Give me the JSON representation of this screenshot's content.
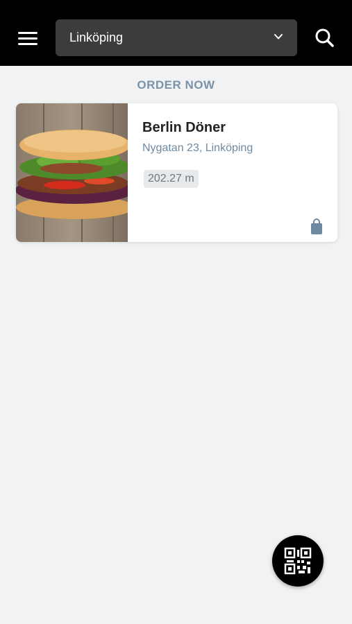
{
  "header": {
    "city_selected": "Linköping"
  },
  "section": {
    "title": "ORDER NOW"
  },
  "restaurants": [
    {
      "name": "Berlin Döner",
      "address": "Nygatan 23, Linköping",
      "distance": "202.27 m"
    }
  ],
  "colors": {
    "header_bg": "#000000",
    "accent": "#7a93a8",
    "page_bg": "#f0f2f4"
  },
  "icons": {
    "menu": "hamburger-menu-icon",
    "dropdown": "chevron-down-icon",
    "search": "search-icon",
    "bag": "shopping-bag-icon",
    "qr": "qr-code-icon"
  }
}
